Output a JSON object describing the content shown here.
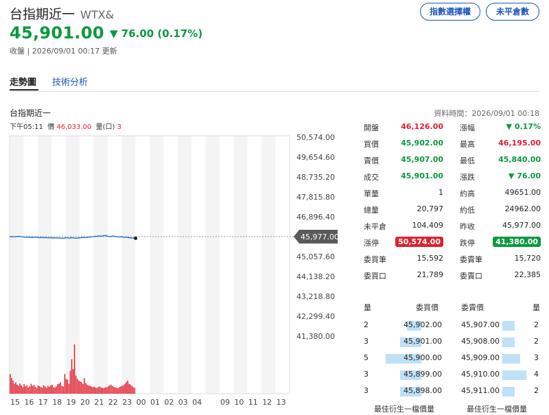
{
  "header": {
    "name": "台指期近一",
    "code": "WTX&",
    "price": "45,901.00",
    "change": "▼ 76.00 (0.17%)",
    "meta": "收盤 | 2026/09/01 00:17 更新",
    "btn_index_options": "指數選擇權",
    "btn_open_interest": "未平倉數"
  },
  "tabs": [
    {
      "label": "走勢圖",
      "active": true
    },
    {
      "label": "技術分析",
      "active": false
    }
  ],
  "chart_header": {
    "title": "台指期近一",
    "data_time": "資料時間：2026/09/01 00:18",
    "time_label": "下午05:11",
    "price_label": "價",
    "price_value": "46,033.00",
    "volume_label": "量(口)",
    "volume_value": "3"
  },
  "chart_data": {
    "type": "line",
    "y_ticks": [
      "50,574.00",
      "49,654.60",
      "48,735.20",
      "47,815.80",
      "46,896.40",
      "45,977.00",
      "45,057.60",
      "44,138.20",
      "43,218.80",
      "42,299.40",
      "41,380.00"
    ],
    "ylim": [
      41380,
      50574
    ],
    "x_ticks": [
      "15",
      "16",
      "17",
      "18",
      "19",
      "20",
      "21",
      "22",
      "23",
      "00",
      "01",
      "02",
      "03",
      "04",
      "",
      "09",
      "10",
      "11",
      "12",
      "13"
    ],
    "reference_price": 45977,
    "reference_label": "45,977.00",
    "line_color": "#1e6fd9",
    "volume_color": "#e0202e",
    "grid": true,
    "price_series": [
      45977,
      45980,
      45970,
      45985,
      45990,
      45975,
      45965,
      45950,
      45960,
      45945,
      45940,
      45955,
      45950,
      45930,
      45940,
      45925,
      45935,
      45920,
      45930,
      45915,
      45925,
      45910,
      45920,
      45905,
      45915,
      45925,
      45910,
      45930,
      45920,
      45905,
      45915,
      45925,
      45940,
      45935,
      45950,
      45960,
      45970,
      45985,
      45995,
      46010,
      46000,
      46020,
      46030,
      45990,
      45980,
      46005,
      45995,
      45975,
      45960,
      45970,
      45945,
      45955,
      45930,
      45920,
      45910,
      45901
    ],
    "volume_series": [
      120,
      95,
      80,
      60,
      70,
      55,
      48,
      62,
      50,
      40,
      58,
      45,
      52,
      38,
      44,
      60,
      48,
      55,
      42,
      35,
      50,
      46,
      40,
      38,
      52,
      44,
      36,
      48,
      42,
      50,
      55,
      40,
      38,
      45,
      58,
      62,
      70,
      48,
      44,
      120,
      90,
      85,
      60,
      140,
      210,
      150,
      300,
      110,
      90,
      80,
      75,
      70,
      60,
      95,
      65,
      55,
      50,
      48,
      45,
      40,
      42,
      38,
      35,
      40,
      44,
      38,
      36,
      34,
      40,
      38,
      45,
      50,
      55,
      48,
      42,
      38,
      36,
      34,
      40,
      44,
      48,
      50,
      60,
      70,
      80,
      60,
      55,
      48,
      40,
      36
    ]
  },
  "quote_table": {
    "left": [
      {
        "label": "開盤",
        "value": "46,126.00",
        "color": "#e0202e"
      },
      {
        "label": "買價",
        "value": "45,902.00",
        "color": "#0a9a3e"
      },
      {
        "label": "賣價",
        "value": "45,907.00",
        "color": "#0a9a3e"
      },
      {
        "label": "成交",
        "value": "45,901.00",
        "color": "#0a9a3e"
      },
      {
        "label": "單量",
        "value": "1",
        "color": "#222222"
      },
      {
        "label": "總量",
        "value": "20,797",
        "color": "#222222"
      },
      {
        "label": "未平倉",
        "value": "104,409",
        "color": "#222222"
      },
      {
        "label": "漲停",
        "value": "50,574.00",
        "color": "badge-red"
      },
      {
        "label": "委買筆",
        "value": "15,592",
        "color": "#222222"
      },
      {
        "label": "委買口",
        "value": "21,789",
        "color": "#222222"
      }
    ],
    "right": [
      {
        "label": "漲幅",
        "value": "▼ 0.17%",
        "color": "#0a9a3e"
      },
      {
        "label": "最高",
        "value": "46,195.00",
        "color": "#e0202e"
      },
      {
        "label": "最低",
        "value": "45,840.00",
        "color": "#0a9a3e"
      },
      {
        "label": "漲跌",
        "value": "▼ 76.00",
        "color": "#0a9a3e"
      },
      {
        "label": "約高",
        "value": "49651.00",
        "color": "#222222"
      },
      {
        "label": "約低",
        "value": "24962.00",
        "color": "#222222"
      },
      {
        "label": "昨收",
        "value": "45,977.00",
        "color": "#222222"
      },
      {
        "label": "跌停",
        "value": "41,380.00",
        "color": "badge-green"
      },
      {
        "label": "委賣筆",
        "value": "15,720",
        "color": "#222222"
      },
      {
        "label": "委賣口",
        "value": "22,385",
        "color": "#222222"
      }
    ]
  },
  "order_book": {
    "headers": {
      "bid_qty": "量",
      "bid_price": "委買價",
      "ask_price": "委賣價",
      "ask_qty": "量"
    },
    "rows": [
      {
        "bid_qty": "2",
        "bid_price": "45,902.00",
        "ask_price": "45,907.00",
        "ask_qty": "2"
      },
      {
        "bid_qty": "3",
        "bid_price": "45,901.00",
        "ask_price": "45,908.00",
        "ask_qty": "2"
      },
      {
        "bid_qty": "5",
        "bid_price": "45,900.00",
        "ask_price": "45,909.00",
        "ask_qty": "3"
      },
      {
        "bid_qty": "3",
        "bid_price": "45,899.00",
        "ask_price": "45,910.00",
        "ask_qty": "4"
      },
      {
        "bid_qty": "3",
        "bid_price": "45,898.00",
        "ask_price": "45,911.00",
        "ask_qty": "2"
      }
    ],
    "footer_bid": "最佳衍生一檔價量",
    "footer_ask": "最佳衍生一檔價量"
  }
}
